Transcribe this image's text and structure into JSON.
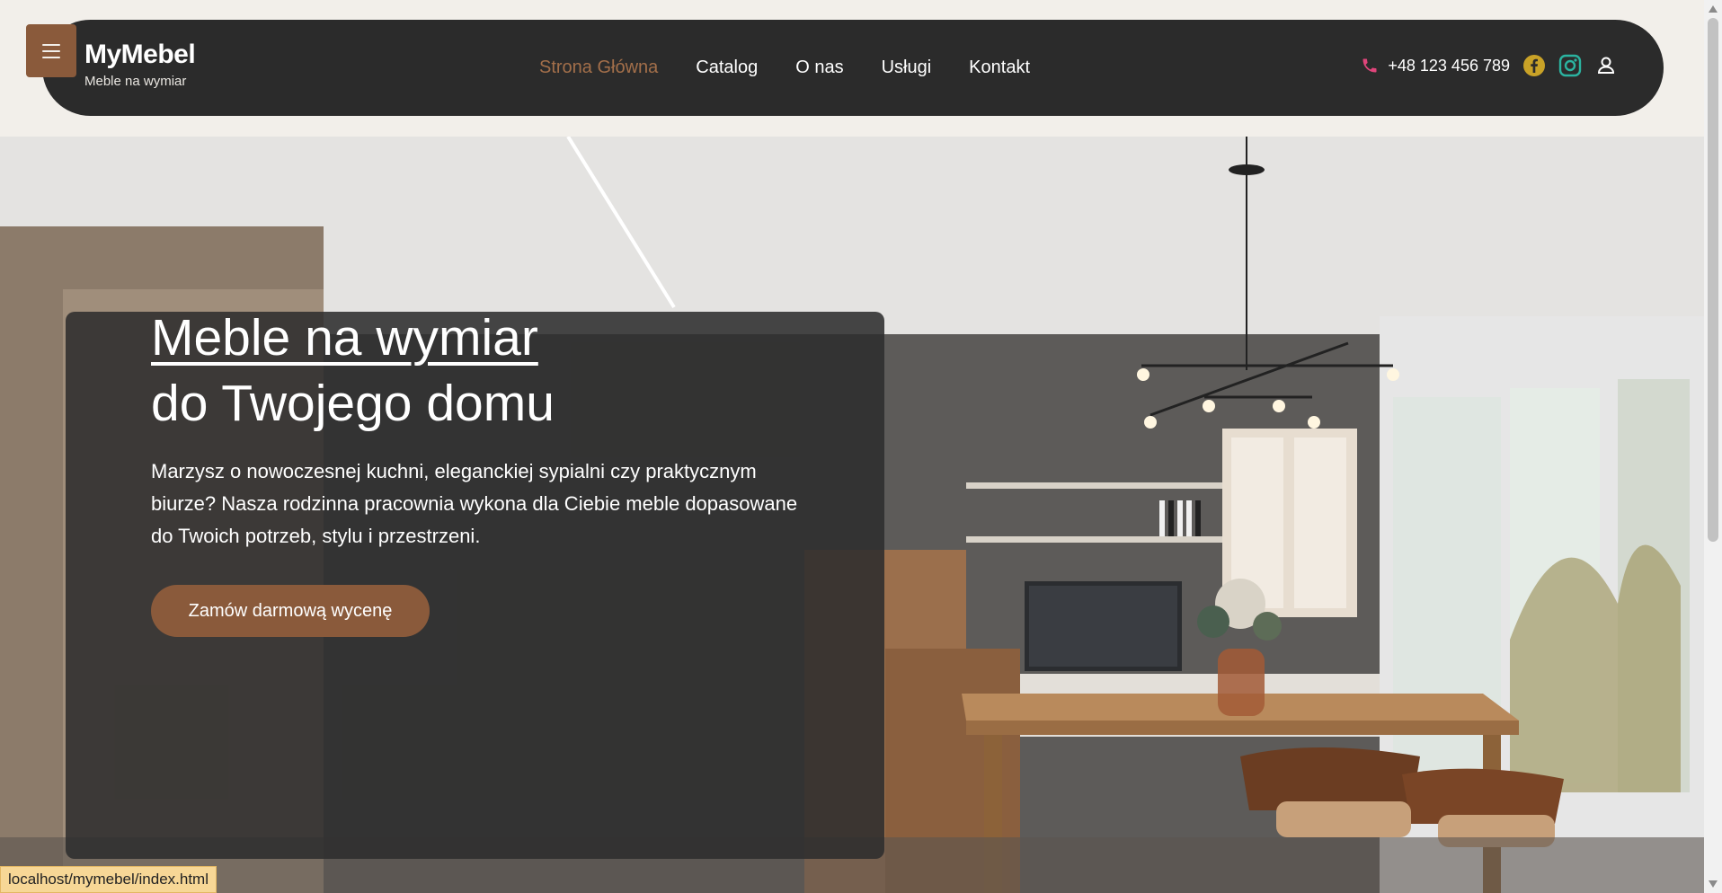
{
  "brand": {
    "title": "MyMebel",
    "subtitle": "Meble na wymiar"
  },
  "nav": {
    "items": [
      {
        "label": "Strona Główna",
        "active": true
      },
      {
        "label": "Catalog",
        "active": false
      },
      {
        "label": "O nas",
        "active": false
      },
      {
        "label": "Usługi",
        "active": false
      },
      {
        "label": "Kontakt",
        "active": false
      }
    ]
  },
  "contact": {
    "phone": "+48 123 456 789"
  },
  "icons": {
    "menu": "hamburger-menu-icon",
    "phone": "phone-icon",
    "facebook": "facebook-icon",
    "instagram": "instagram-icon",
    "user": "user-icon"
  },
  "hero": {
    "title_line1": "Meble na wymiar",
    "title_line2": "do Twojego domu",
    "description": "Marzysz o nowoczesnej kuchni, eleganckiej sypialni czy praktycznym biurze? Nasza rodzinna pracownia wykona dla Ciebie meble dopasowane do Twoich potrzeb, stylu i przestrzeni.",
    "cta_label": "Zamów darmową wycenę"
  },
  "status_bar": {
    "url": "localhost/mymebel/index.html"
  },
  "colors": {
    "accent": "#8a5a3b",
    "active_nav": "#a36f4a",
    "header_bg": "#2b2b2b",
    "page_bg": "#f2efea",
    "phone_icon": "#e0457b",
    "facebook_icon": "#c9a227",
    "instagram_icon": "#2bb3a0"
  }
}
